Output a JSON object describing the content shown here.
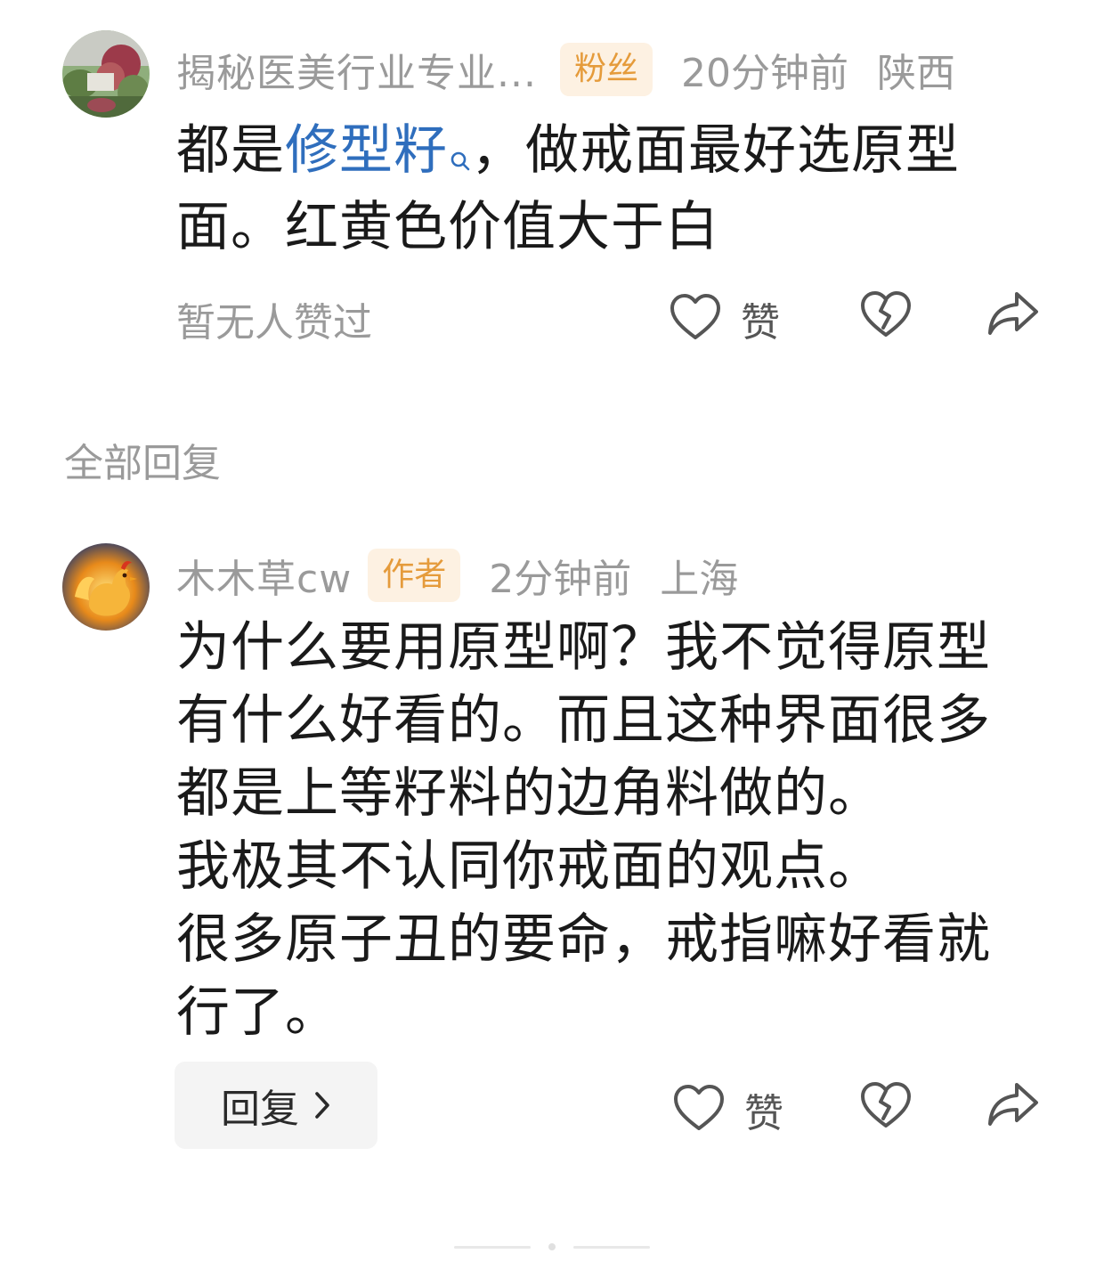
{
  "comment": {
    "username": "揭秘医美行业专业...",
    "badge": "粉丝",
    "time": "20分钟前",
    "location": "陕西",
    "content_before": "都是",
    "content_link": "修型籽",
    "content_after_line1": "，做戒面最好选原型",
    "content_line2": "面。红黄色价值大于白",
    "no_likes": "暂无人赞过",
    "like_label": "赞",
    "icons": [
      "search-icon",
      "heart-icon",
      "broken-heart-icon",
      "share-icon"
    ]
  },
  "section_title": "全部回复",
  "reply": {
    "username": "木木草cw",
    "badge": "作者",
    "time": "2分钟前",
    "location": "上海",
    "lines": [
      "为什么要用原型啊？我不觉得原型",
      "有什么好看的。而且这种界面很多",
      "都是上等籽料的边角料做的。",
      "我极其不认同你戒面的观点。",
      "很多原子丑的要命，戒指嘛好看就",
      "行了。"
    ],
    "reply_button": "回复",
    "like_label": "赞",
    "icons": [
      "heart-icon",
      "broken-heart-icon",
      "share-icon",
      "chevron-right-icon"
    ]
  },
  "colors": {
    "badge_text": "#e59b3b",
    "badge_bg": "#fdf1e2",
    "link": "#2f6ebd",
    "meta": "#9a9a9a"
  }
}
